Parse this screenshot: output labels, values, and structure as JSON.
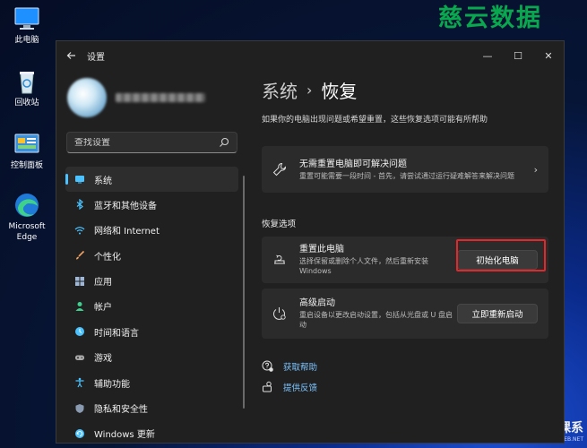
{
  "desktop": {
    "icons": [
      {
        "label": "此电脑"
      },
      {
        "label": "回收站"
      },
      {
        "label": "控制面板"
      },
      {
        "label": "Microsoft Edge"
      }
    ],
    "watermark_top": "慈云数据",
    "watermark_bottom": "球鹅头云课系",
    "watermark_url": "www.PEB.NET"
  },
  "window": {
    "title": "设置",
    "controls": {
      "minimize": "—",
      "maximize": "☐",
      "close": "✕"
    }
  },
  "sidebar": {
    "search_placeholder": "查找设置",
    "items": [
      {
        "label": "系统",
        "icon": "monitor-icon",
        "color": "#4cc2ff"
      },
      {
        "label": "蓝牙和其他设备",
        "icon": "bluetooth-icon",
        "color": "#4cc2ff"
      },
      {
        "label": "网络和 Internet",
        "icon": "wifi-icon",
        "color": "#4cc2ff"
      },
      {
        "label": "个性化",
        "icon": "brush-icon",
        "color": "#f0a060"
      },
      {
        "label": "应用",
        "icon": "apps-icon",
        "color": "#9fb8d8"
      },
      {
        "label": "帐户",
        "icon": "person-icon",
        "color": "#3ecf8e"
      },
      {
        "label": "时间和语言",
        "icon": "globe-clock-icon",
        "color": "#4cc2ff"
      },
      {
        "label": "游戏",
        "icon": "gamepad-icon",
        "color": "#aaaaaa"
      },
      {
        "label": "辅助功能",
        "icon": "accessibility-icon",
        "color": "#4cc2ff"
      },
      {
        "label": "隐私和安全性",
        "icon": "shield-icon",
        "color": "#8a9ab0"
      },
      {
        "label": "Windows 更新",
        "icon": "update-icon",
        "color": "#4cc2ff"
      }
    ]
  },
  "main": {
    "breadcrumb_parent": "系统",
    "breadcrumb_sep": "›",
    "breadcrumb_current": "恢复",
    "subtitle": "如果你的电脑出现问题或希望重置，这些恢复选项可能有所帮助",
    "troubleshoot": {
      "title": "无需重置电脑即可解决问题",
      "desc": "重置可能需要一段时间 - 首先，请尝试通过运行疑难解答来解决问题",
      "chevron": "›"
    },
    "section_label": "恢复选项",
    "reset": {
      "title": "重置此电脑",
      "desc": "选择保留或删除个人文件，然后重新安装 Windows",
      "button": "初始化电脑"
    },
    "advanced": {
      "title": "高级启动",
      "desc": "重启设备以更改启动设置，包括从光盘或 U 盘启动",
      "button": "立即重新启动"
    },
    "links": [
      {
        "label": "获取帮助",
        "icon": "help-icon"
      },
      {
        "label": "提供反馈",
        "icon": "feedback-icon"
      }
    ]
  },
  "colors": {
    "accent": "#4cc2ff",
    "highlight_box": "#e5262a",
    "link": "#7cc4ff"
  }
}
